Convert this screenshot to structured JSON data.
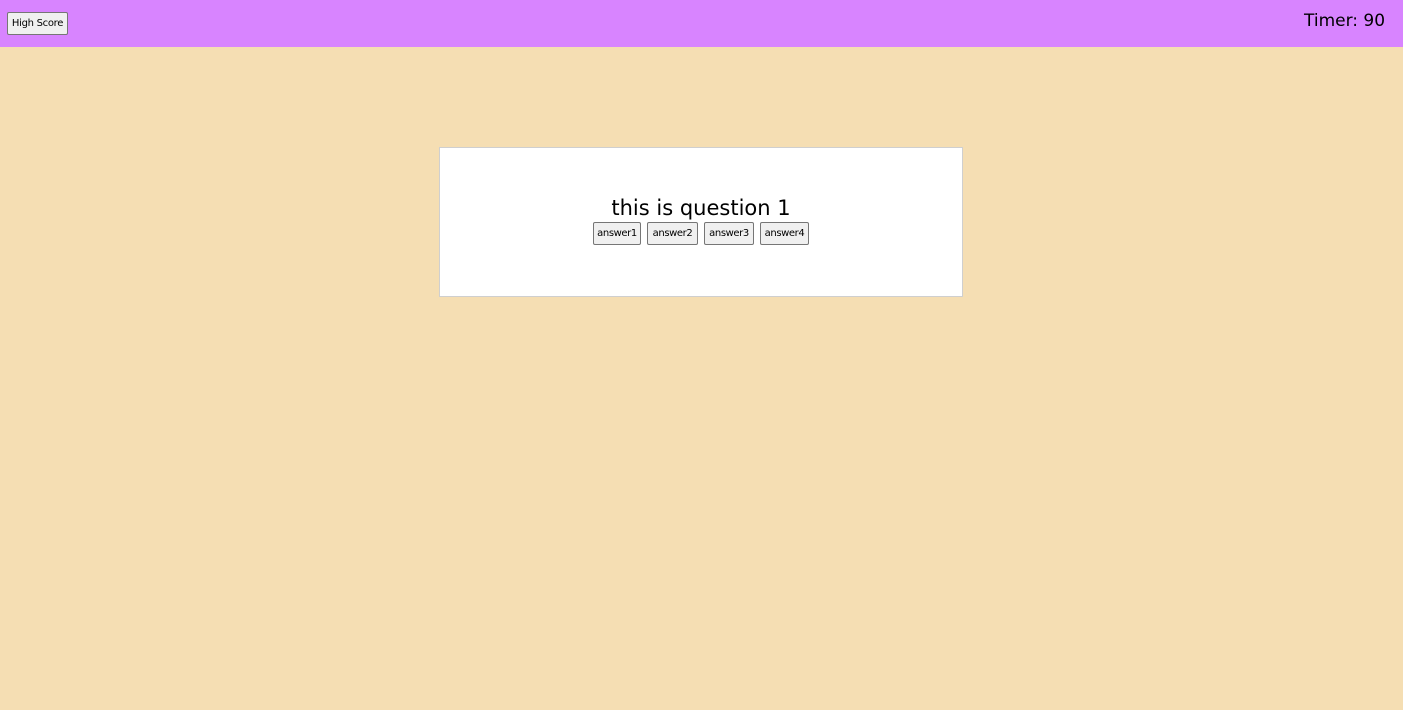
{
  "header": {
    "high_score_label": "High Score",
    "timer_label": "Timer: 90"
  },
  "quiz": {
    "question": "this is question 1",
    "answers": [
      "answer1",
      "answer2",
      "answer3",
      "answer4"
    ]
  },
  "colors": {
    "page_background": "#f5deb3",
    "header_background": "#d884ff",
    "card_background": "#ffffff"
  }
}
